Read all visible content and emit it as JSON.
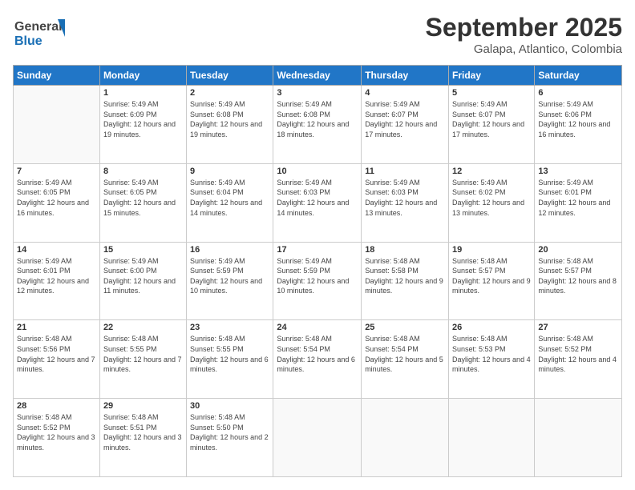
{
  "header": {
    "title": "September 2025",
    "subtitle": "Galapa, Atlantico, Colombia",
    "logo_general": "General",
    "logo_blue": "Blue"
  },
  "days_of_week": [
    "Sunday",
    "Monday",
    "Tuesday",
    "Wednesday",
    "Thursday",
    "Friday",
    "Saturday"
  ],
  "weeks": [
    [
      {
        "day": "",
        "info": ""
      },
      {
        "day": "1",
        "info": "Sunrise: 5:49 AM\nSunset: 6:09 PM\nDaylight: 12 hours\nand 19 minutes."
      },
      {
        "day": "2",
        "info": "Sunrise: 5:49 AM\nSunset: 6:08 PM\nDaylight: 12 hours\nand 19 minutes."
      },
      {
        "day": "3",
        "info": "Sunrise: 5:49 AM\nSunset: 6:08 PM\nDaylight: 12 hours\nand 18 minutes."
      },
      {
        "day": "4",
        "info": "Sunrise: 5:49 AM\nSunset: 6:07 PM\nDaylight: 12 hours\nand 17 minutes."
      },
      {
        "day": "5",
        "info": "Sunrise: 5:49 AM\nSunset: 6:07 PM\nDaylight: 12 hours\nand 17 minutes."
      },
      {
        "day": "6",
        "info": "Sunrise: 5:49 AM\nSunset: 6:06 PM\nDaylight: 12 hours\nand 16 minutes."
      }
    ],
    [
      {
        "day": "7",
        "info": "Sunrise: 5:49 AM\nSunset: 6:05 PM\nDaylight: 12 hours\nand 16 minutes."
      },
      {
        "day": "8",
        "info": "Sunrise: 5:49 AM\nSunset: 6:05 PM\nDaylight: 12 hours\nand 15 minutes."
      },
      {
        "day": "9",
        "info": "Sunrise: 5:49 AM\nSunset: 6:04 PM\nDaylight: 12 hours\nand 14 minutes."
      },
      {
        "day": "10",
        "info": "Sunrise: 5:49 AM\nSunset: 6:03 PM\nDaylight: 12 hours\nand 14 minutes."
      },
      {
        "day": "11",
        "info": "Sunrise: 5:49 AM\nSunset: 6:03 PM\nDaylight: 12 hours\nand 13 minutes."
      },
      {
        "day": "12",
        "info": "Sunrise: 5:49 AM\nSunset: 6:02 PM\nDaylight: 12 hours\nand 13 minutes."
      },
      {
        "day": "13",
        "info": "Sunrise: 5:49 AM\nSunset: 6:01 PM\nDaylight: 12 hours\nand 12 minutes."
      }
    ],
    [
      {
        "day": "14",
        "info": "Sunrise: 5:49 AM\nSunset: 6:01 PM\nDaylight: 12 hours\nand 12 minutes."
      },
      {
        "day": "15",
        "info": "Sunrise: 5:49 AM\nSunset: 6:00 PM\nDaylight: 12 hours\nand 11 minutes."
      },
      {
        "day": "16",
        "info": "Sunrise: 5:49 AM\nSunset: 5:59 PM\nDaylight: 12 hours\nand 10 minutes."
      },
      {
        "day": "17",
        "info": "Sunrise: 5:49 AM\nSunset: 5:59 PM\nDaylight: 12 hours\nand 10 minutes."
      },
      {
        "day": "18",
        "info": "Sunrise: 5:48 AM\nSunset: 5:58 PM\nDaylight: 12 hours\nand 9 minutes."
      },
      {
        "day": "19",
        "info": "Sunrise: 5:48 AM\nSunset: 5:57 PM\nDaylight: 12 hours\nand 9 minutes."
      },
      {
        "day": "20",
        "info": "Sunrise: 5:48 AM\nSunset: 5:57 PM\nDaylight: 12 hours\nand 8 minutes."
      }
    ],
    [
      {
        "day": "21",
        "info": "Sunrise: 5:48 AM\nSunset: 5:56 PM\nDaylight: 12 hours\nand 7 minutes."
      },
      {
        "day": "22",
        "info": "Sunrise: 5:48 AM\nSunset: 5:55 PM\nDaylight: 12 hours\nand 7 minutes."
      },
      {
        "day": "23",
        "info": "Sunrise: 5:48 AM\nSunset: 5:55 PM\nDaylight: 12 hours\nand 6 minutes."
      },
      {
        "day": "24",
        "info": "Sunrise: 5:48 AM\nSunset: 5:54 PM\nDaylight: 12 hours\nand 6 minutes."
      },
      {
        "day": "25",
        "info": "Sunrise: 5:48 AM\nSunset: 5:54 PM\nDaylight: 12 hours\nand 5 minutes."
      },
      {
        "day": "26",
        "info": "Sunrise: 5:48 AM\nSunset: 5:53 PM\nDaylight: 12 hours\nand 4 minutes."
      },
      {
        "day": "27",
        "info": "Sunrise: 5:48 AM\nSunset: 5:52 PM\nDaylight: 12 hours\nand 4 minutes."
      }
    ],
    [
      {
        "day": "28",
        "info": "Sunrise: 5:48 AM\nSunset: 5:52 PM\nDaylight: 12 hours\nand 3 minutes."
      },
      {
        "day": "29",
        "info": "Sunrise: 5:48 AM\nSunset: 5:51 PM\nDaylight: 12 hours\nand 3 minutes."
      },
      {
        "day": "30",
        "info": "Sunrise: 5:48 AM\nSunset: 5:50 PM\nDaylight: 12 hours\nand 2 minutes."
      },
      {
        "day": "",
        "info": ""
      },
      {
        "day": "",
        "info": ""
      },
      {
        "day": "",
        "info": ""
      },
      {
        "day": "",
        "info": ""
      }
    ]
  ]
}
